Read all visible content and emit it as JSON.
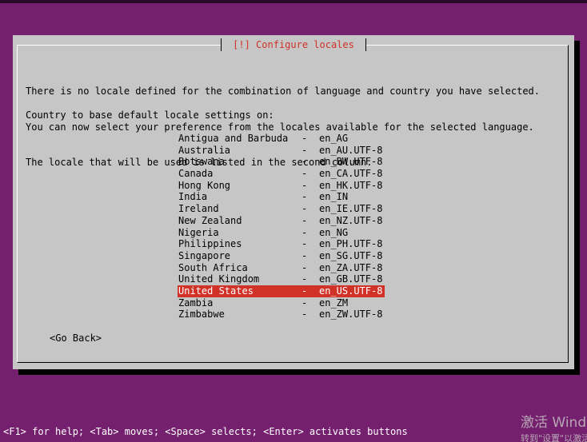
{
  "dialog": {
    "title": "[!] Configure locales",
    "intro_lines": [
      "There is no locale defined for the combination of language and country you have selected.",
      "You can now select your preference from the locales available for the selected language.",
      "The locale that will be used is listed in the second column."
    ],
    "country_prompt": "Country to base default locale settings on:",
    "separator": "-",
    "locales": [
      {
        "country": "Antigua and Barbuda",
        "code": "en_AG"
      },
      {
        "country": "Australia",
        "code": "en_AU.UTF-8"
      },
      {
        "country": "Botswana",
        "code": "en_BW.UTF-8"
      },
      {
        "country": "Canada",
        "code": "en_CA.UTF-8"
      },
      {
        "country": "Hong Kong",
        "code": "en_HK.UTF-8"
      },
      {
        "country": "India",
        "code": "en_IN"
      },
      {
        "country": "Ireland",
        "code": "en_IE.UTF-8"
      },
      {
        "country": "New Zealand",
        "code": "en_NZ.UTF-8"
      },
      {
        "country": "Nigeria",
        "code": "en_NG"
      },
      {
        "country": "Philippines",
        "code": "en_PH.UTF-8"
      },
      {
        "country": "Singapore",
        "code": "en_SG.UTF-8"
      },
      {
        "country": "South Africa",
        "code": "en_ZA.UTF-8"
      },
      {
        "country": "United Kingdom",
        "code": "en_GB.UTF-8"
      },
      {
        "country": "United States",
        "code": "en_US.UTF-8"
      },
      {
        "country": "Zambia",
        "code": "en_ZM"
      },
      {
        "country": "Zimbabwe",
        "code": "en_ZW.UTF-8"
      }
    ],
    "selected_index": 13,
    "go_back_label": "<Go Back>"
  },
  "footer": {
    "help_text": "<F1> for help; <Tab> moves; <Space> selects; <Enter> activates buttons"
  },
  "watermark": {
    "line1": "激活 Windows",
    "line2": "转到\"设置\"以激活 Windows。"
  },
  "colors": {
    "background": "#75206e",
    "dialog": "#c6c6c6",
    "accent": "#d03228",
    "text": "#000000",
    "help_text": "#ffffff"
  }
}
